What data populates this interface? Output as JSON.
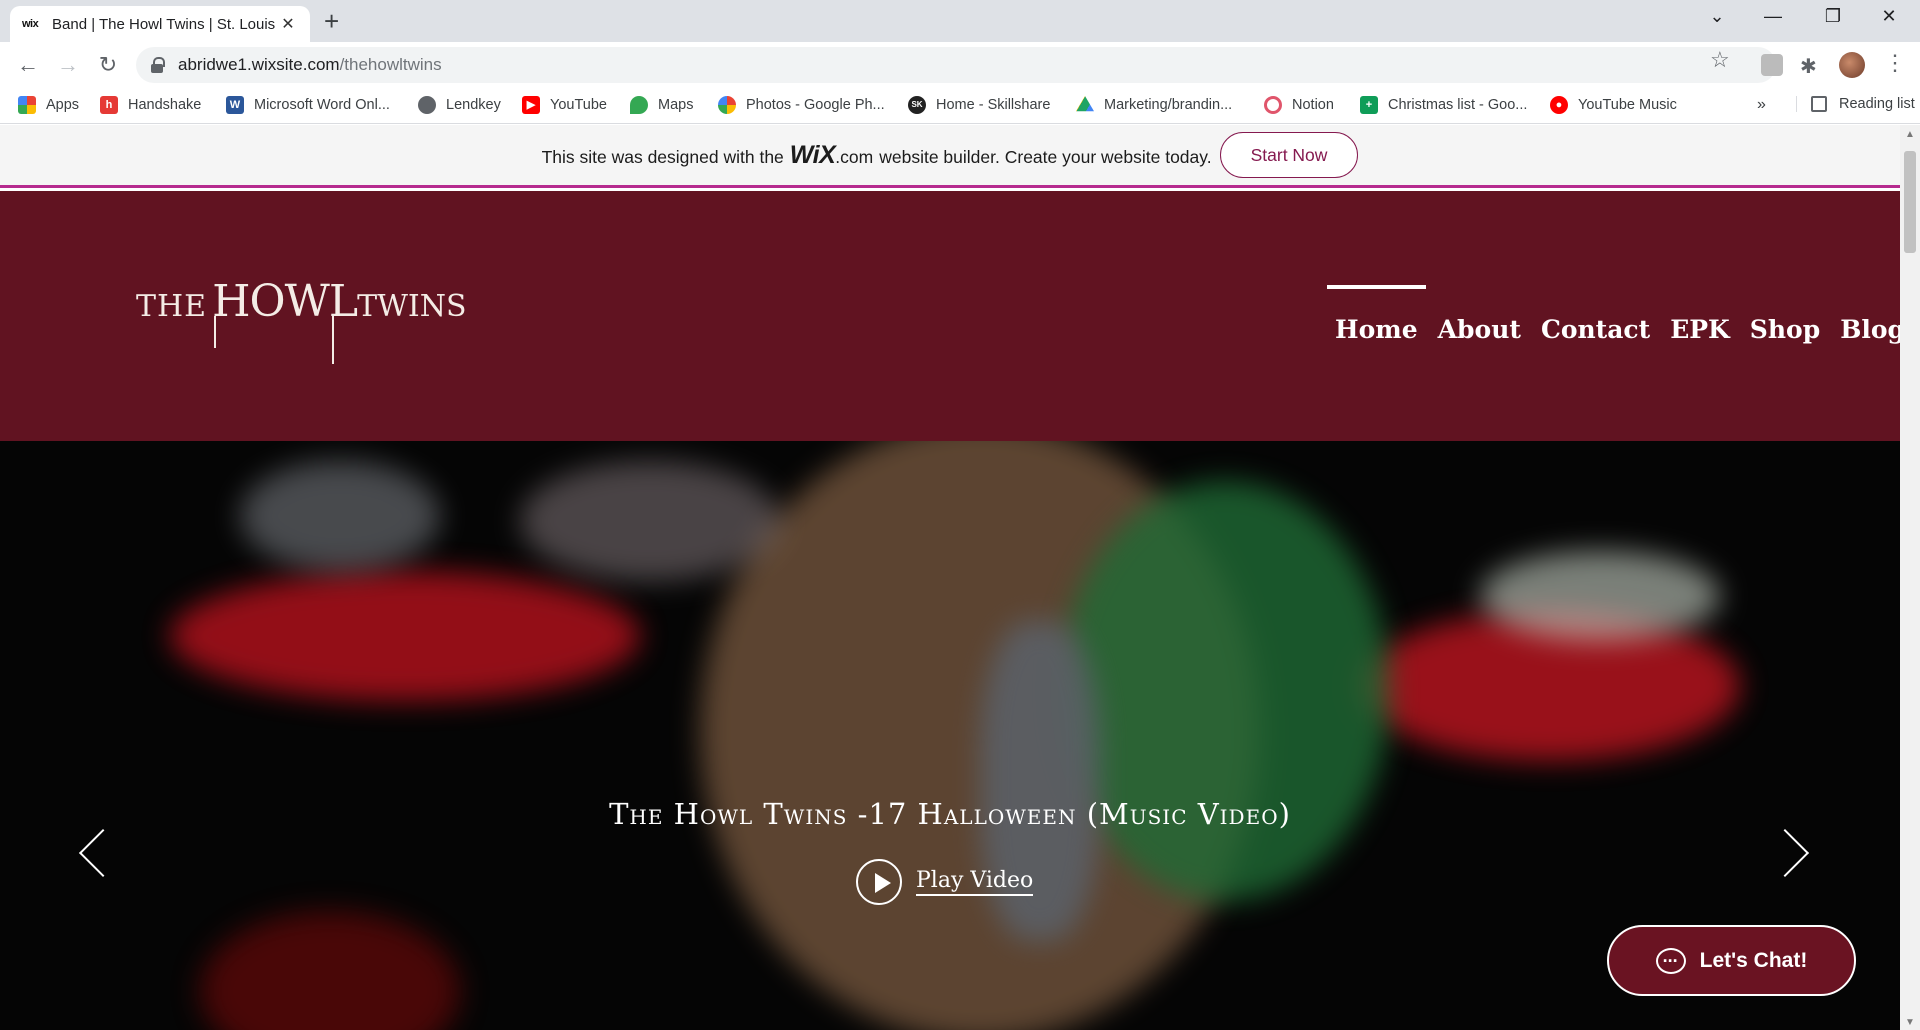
{
  "browser": {
    "tab_title": "Band | The Howl Twins | St. Louis",
    "tab_favicon": "wix",
    "url_host": "abridwe1.wixsite.com",
    "url_path": "/thehowltwins",
    "bookmarks": [
      {
        "label": "Apps",
        "icon": "apps-grid-icon",
        "color": "#4285f4"
      },
      {
        "label": "Handshake",
        "icon": "handshake-icon",
        "color": "#e53935"
      },
      {
        "label": "Microsoft Word Onl...",
        "icon": "word-icon",
        "color": "#2b579a"
      },
      {
        "label": "Lendkey",
        "icon": "globe-icon",
        "color": "#5f6368"
      },
      {
        "label": "YouTube",
        "icon": "youtube-icon",
        "color": "#ff0000"
      },
      {
        "label": "Maps",
        "icon": "maps-icon",
        "color": "#34a853"
      },
      {
        "label": "Photos - Google Ph...",
        "icon": "photos-icon",
        "color": "#fbbc04"
      },
      {
        "label": "Home - Skillshare",
        "icon": "skillshare-icon",
        "color": "#222222"
      },
      {
        "label": "Marketing/brandin...",
        "icon": "drive-icon",
        "color": "#1fa463"
      },
      {
        "label": "Notion",
        "icon": "notion-icon",
        "color": "#e0556b"
      },
      {
        "label": "Christmas list - Goo...",
        "icon": "sheets-icon",
        "color": "#0f9d58"
      },
      {
        "label": "YouTube Music",
        "icon": "youtube-music-icon",
        "color": "#ff0000"
      }
    ],
    "bookmarks_more": "»",
    "reading_list": "Reading list"
  },
  "wix_banner": {
    "text_before": "This site was designed with the",
    "logo": "WiX",
    "logo_suffix": ".com",
    "text_after": "website builder. Create your website today.",
    "cta": "Start Now"
  },
  "site": {
    "logo_the": "THE",
    "logo_howl": "HOWL",
    "logo_twins": "TWINS",
    "nav": [
      "Home",
      "About",
      "Contact",
      "EPK",
      "Shop",
      "Blog"
    ],
    "active_nav": "Home",
    "colors": {
      "header_bg": "#611321",
      "accent": "#b62a8f"
    }
  },
  "hero": {
    "title": "The Howl Twins -17 Halloween (Music Video)",
    "play_label": "Play Video"
  },
  "chat": {
    "label": "Let's Chat!"
  }
}
